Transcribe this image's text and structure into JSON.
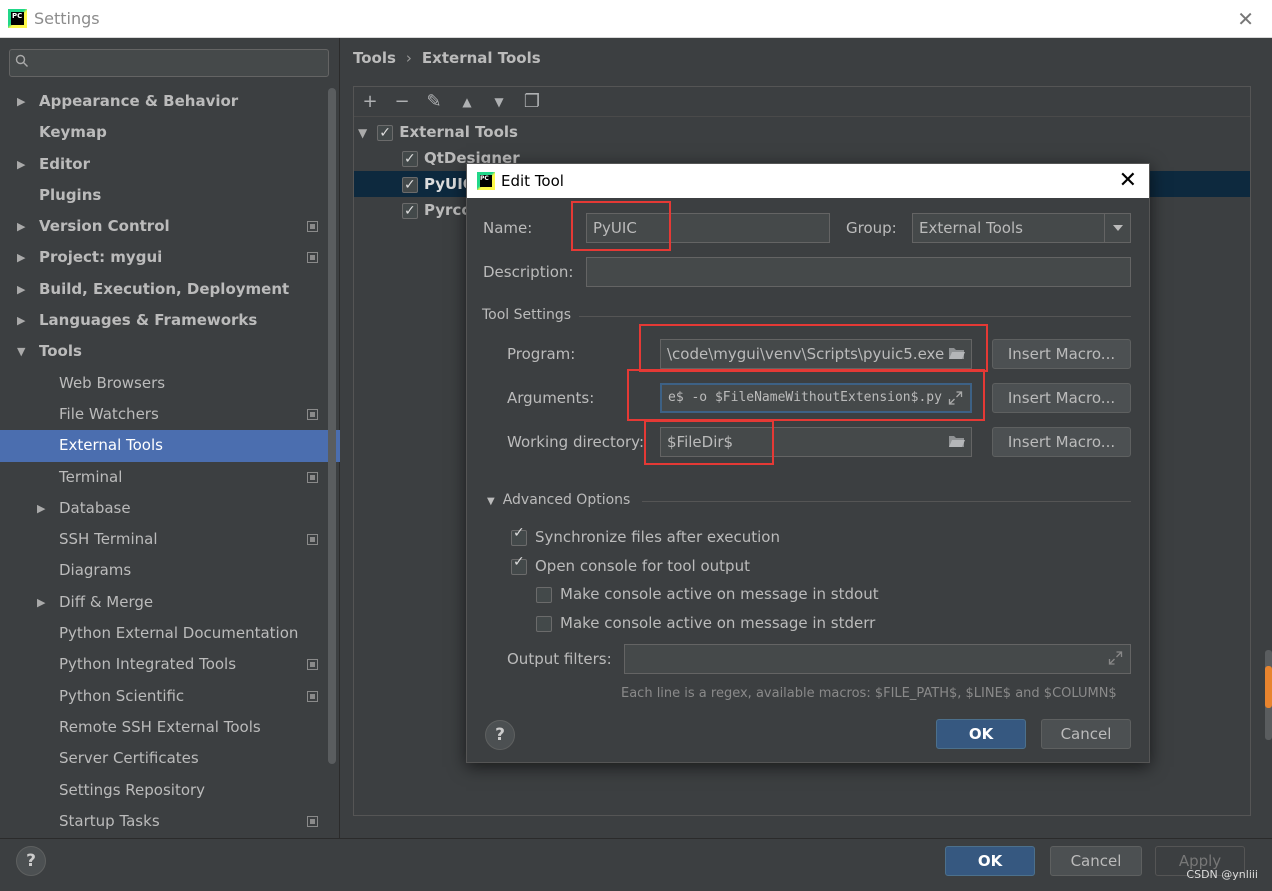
{
  "window": {
    "title": "Settings",
    "logo_text": "PC"
  },
  "search": {
    "placeholder": ""
  },
  "sidebar": {
    "items": [
      {
        "label": "Appearance & Behavior",
        "level": 0,
        "arrow": "▶"
      },
      {
        "label": "Keymap",
        "level": 0
      },
      {
        "label": "Editor",
        "level": 0,
        "arrow": "▶"
      },
      {
        "label": "Plugins",
        "level": 0
      },
      {
        "label": "Version Control",
        "level": 0,
        "arrow": "▶",
        "proj": true
      },
      {
        "label": "Project: mygui",
        "level": 0,
        "arrow": "▶",
        "proj": true
      },
      {
        "label": "Build, Execution, Deployment",
        "level": 0,
        "arrow": "▶"
      },
      {
        "label": "Languages & Frameworks",
        "level": 0,
        "arrow": "▶"
      },
      {
        "label": "Tools",
        "level": 0,
        "arrow": "▼"
      },
      {
        "label": "Web Browsers",
        "level": 1
      },
      {
        "label": "File Watchers",
        "level": 1,
        "proj": true
      },
      {
        "label": "External Tools",
        "level": 1,
        "selected": true
      },
      {
        "label": "Terminal",
        "level": 1,
        "proj": true
      },
      {
        "label": "Database",
        "level": 1,
        "arrow": "▶"
      },
      {
        "label": "SSH Terminal",
        "level": 1,
        "proj": true
      },
      {
        "label": "Diagrams",
        "level": 1
      },
      {
        "label": "Diff & Merge",
        "level": 1,
        "arrow": "▶"
      },
      {
        "label": "Python External Documentation",
        "level": 1
      },
      {
        "label": "Python Integrated Tools",
        "level": 1,
        "proj": true
      },
      {
        "label": "Python Scientific",
        "level": 1,
        "proj": true
      },
      {
        "label": "Remote SSH External Tools",
        "level": 1
      },
      {
        "label": "Server Certificates",
        "level": 1
      },
      {
        "label": "Settings Repository",
        "level": 1
      },
      {
        "label": "Startup Tasks",
        "level": 1,
        "proj": true
      }
    ]
  },
  "breadcrumb": {
    "root": "Tools",
    "sep": "›",
    "leaf": "External Tools"
  },
  "toolbar": {
    "add": "+",
    "remove": "−",
    "edit": "✎",
    "up": "▲",
    "down": "▼",
    "copy": "❐"
  },
  "tool_tree": {
    "group_arrow": "▼",
    "group": "External Tools",
    "tools": [
      "QtDesigner",
      "PyUIC",
      "Pyrcc"
    ]
  },
  "dialog": {
    "title": "Edit Tool",
    "close": "✕",
    "name_label": "Name:",
    "name_value": "PyUIC",
    "group_label": "Group:",
    "group_value": "External Tools",
    "description_label": "Description:",
    "description_value": "",
    "tool_settings": "Tool Settings",
    "program_label": "Program:",
    "program_value": "\\code\\mygui\\venv\\Scripts\\pyuic5.exe",
    "arguments_label": "Arguments:",
    "arguments_value": "e$ -o $FileNameWithoutExtension$.py",
    "workdir_label": "Working directory:",
    "workdir_value": "$FileDir$",
    "insert_macro": "Insert Macro...",
    "advanced_arrow": "▼",
    "advanced": "Advanced Options",
    "sync_files": "Synchronize files after execution",
    "open_console": "Open console for tool output",
    "console_stdout": "Make console active on message in stdout",
    "console_stderr": "Make console active on message in stderr",
    "output_filters_label": "Output filters:",
    "output_filters_value": "",
    "hint": "Each line is a regex, available macros: $FILE_PATH$, $LINE$ and $COLUMN$",
    "help": "?",
    "ok": "OK",
    "cancel": "Cancel"
  },
  "bottom": {
    "help": "?",
    "ok": "OK",
    "cancel": "Cancel",
    "apply": "Apply",
    "watermark": "CSDN @ynliii"
  },
  "colors": {
    "accent": "#4b6eaf",
    "highlight": "#e53935",
    "primary_button": "#365880"
  }
}
